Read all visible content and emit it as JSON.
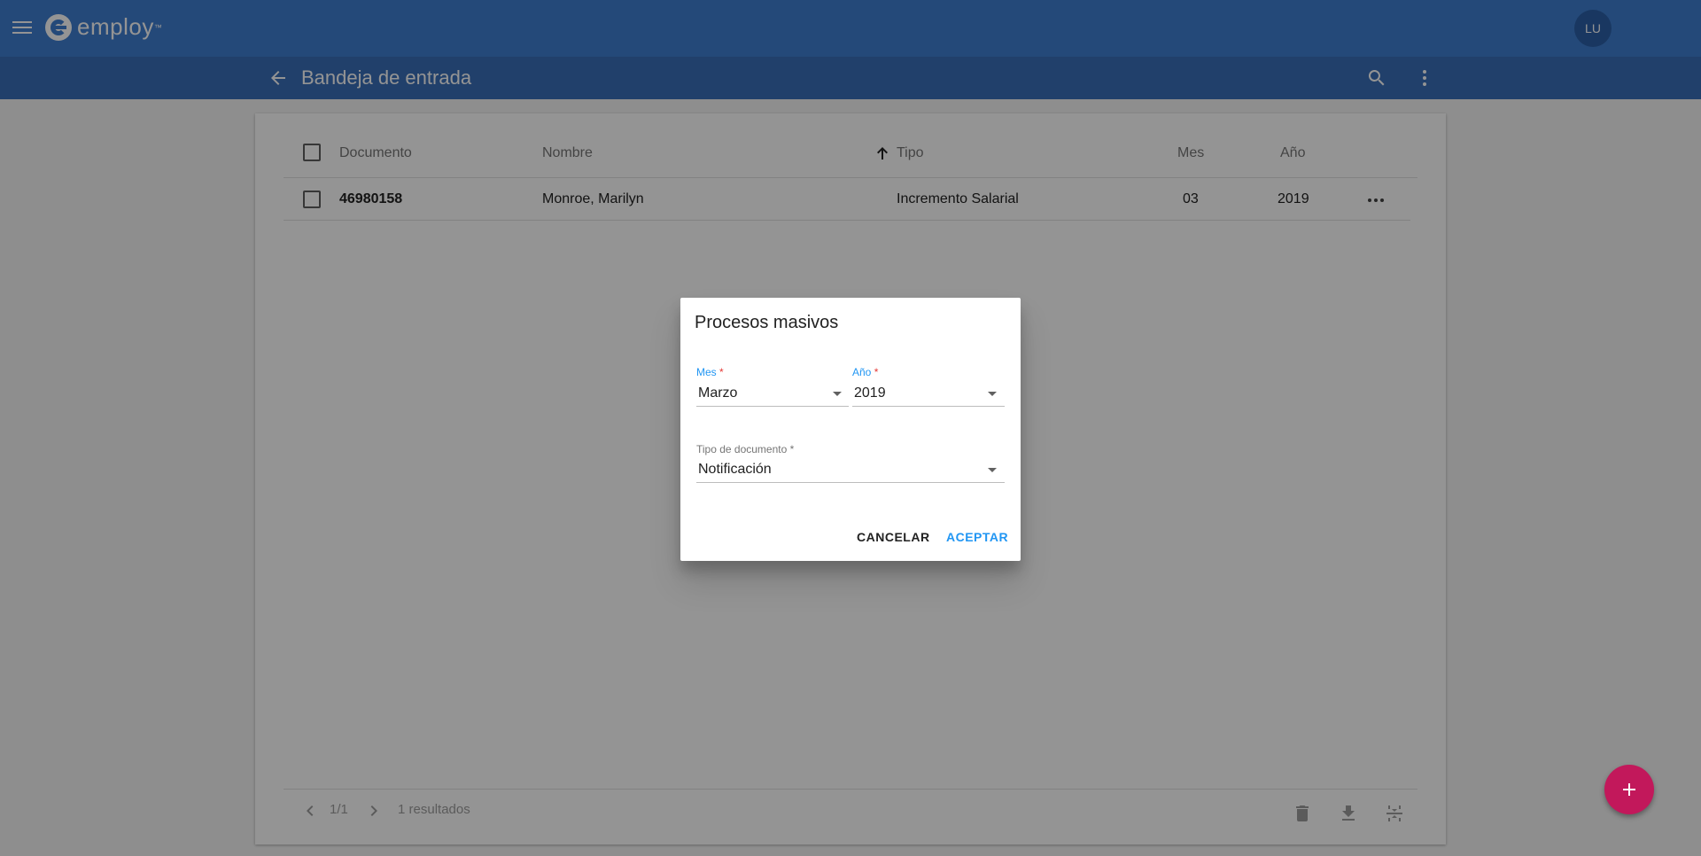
{
  "app": {
    "brand": "employ",
    "brand_mark": "™",
    "avatar_initials": "LU"
  },
  "subbar": {
    "title": "Bandeja de entrada"
  },
  "table": {
    "columns": [
      "Documento",
      "Nombre",
      "Tipo",
      "Mes",
      "Año"
    ],
    "rows": [
      {
        "documento": "46980158",
        "nombre": "Monroe, Marilyn",
        "tipo": "Incremento Salarial",
        "mes": "03",
        "anio": "2019"
      }
    ]
  },
  "pagination": {
    "page": "1/1",
    "results": "1 resultados"
  },
  "dialog": {
    "title": "Procesos masivos",
    "mes_label": "Mes",
    "mes_value": "Marzo",
    "anio_label": "Año",
    "anio_value": "2019",
    "tipo_label": "Tipo de documento",
    "tipo_value": "Notificación",
    "required_mark": "*",
    "cancel_label": "CANCELAR",
    "accept_label": "ACEPTAR"
  },
  "colors": {
    "appbar": "#3f7fd0",
    "subbar": "#3a6fb8",
    "accent": "#2196f3",
    "fab": "#c2185b"
  },
  "icons": [
    "menu-icon",
    "logo-icon",
    "arrow-back-icon",
    "search-icon",
    "more-vert-icon",
    "arrow-upward-icon",
    "more-horiz-icon",
    "chevron-left-icon",
    "chevron-right-icon",
    "delete-icon",
    "download-icon",
    "split-icon",
    "add-icon",
    "dropdown-arrow-icon"
  ]
}
